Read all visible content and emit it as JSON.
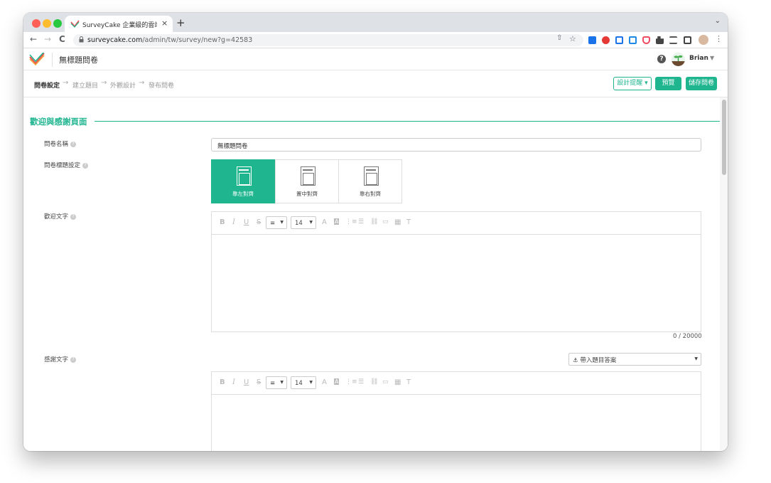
{
  "browser": {
    "tab_title": "SurveyCake 企業級的雲端問卷",
    "tab_close": "×",
    "new_tab": "+",
    "url_host": "surveycake.com",
    "url_path": "/admin/tw/survey/new?g=42583",
    "nav_back": "←",
    "nav_forward": "→",
    "nav_reload": "C",
    "share_icon": "⇧",
    "star_icon": "☆",
    "menu_icon": "⋮",
    "tabs_dropdown": "⌄",
    "lock_icon": "🔒",
    "colors": {
      "red": "#ff5f57",
      "yellow": "#febc2e",
      "green": "#28c840"
    }
  },
  "header": {
    "title": "無標題問卷",
    "help_icon": "?",
    "user_name": "Brian",
    "user_caret": "▼"
  },
  "steps": {
    "items": [
      "問卷設定",
      "建立題目",
      "外觀設計",
      "發布問卷"
    ],
    "arrow": "→",
    "design_tips": "設計提醒 ▾",
    "preview": "預覽",
    "save": "儲存問卷"
  },
  "section": {
    "title": "歡迎與感謝頁面"
  },
  "form": {
    "name_label": "問卷名稱",
    "name_value": "無標題問卷",
    "title_align_label": "問卷標題設定",
    "align_options": [
      "靠左對齊",
      "置中對齊",
      "靠右對齊"
    ],
    "welcome_label": "歡迎文字",
    "welcome_count": "0 / 20000",
    "thanks_label": "感謝文字",
    "insert_answer": "⚓ 帶入題目答案",
    "help_glyph": "?"
  },
  "toolbar": {
    "bold": "B",
    "italic": "I",
    "underline": "U",
    "strike": "S",
    "align": "≡",
    "size": "14",
    "caret": "▼",
    "font_color": "A",
    "bg_color": "A",
    "ordered_list": "⋮≡",
    "bullet_list": "☰",
    "link": "⛓",
    "image": "▭",
    "table": "▦",
    "clear": "T"
  },
  "theme": {
    "accent": "#1fb58f"
  }
}
